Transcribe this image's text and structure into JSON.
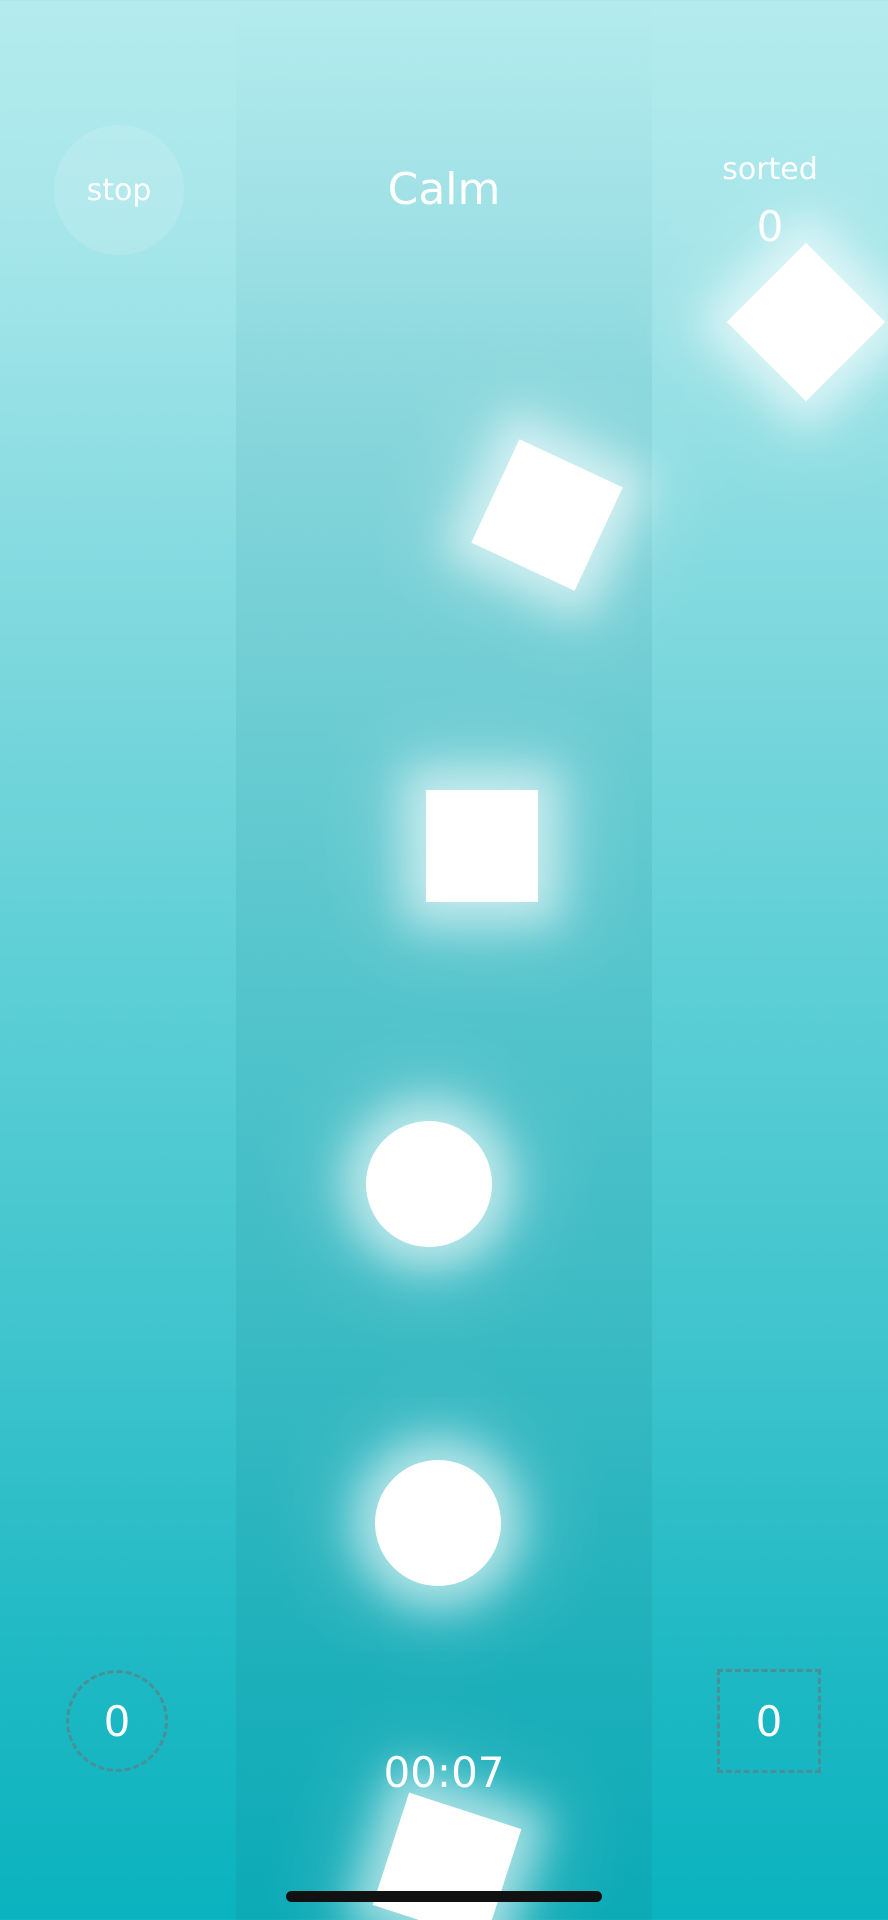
{
  "header": {
    "stop_label": "stop",
    "mode_title": "Calm",
    "sorted_label": "sorted",
    "sorted_count": "0"
  },
  "bins": {
    "circle_count": "0",
    "square_count": "0"
  },
  "timer": "00:07",
  "colors": {
    "background_top": "#b4ebee",
    "background_bottom": "#0ab3bf",
    "bin_outline": "#4a8f96",
    "shape_fill": "#ffffff"
  },
  "shapes": [
    {
      "name": "diamond-shape-top-right",
      "kind": "square"
    },
    {
      "name": "tilted-square-shape",
      "kind": "square"
    },
    {
      "name": "square-shape",
      "kind": "square"
    },
    {
      "name": "circle-shape-upper",
      "kind": "circle"
    },
    {
      "name": "circle-shape-lower",
      "kind": "circle"
    },
    {
      "name": "tilted-square-shape-bottom",
      "kind": "square"
    }
  ]
}
